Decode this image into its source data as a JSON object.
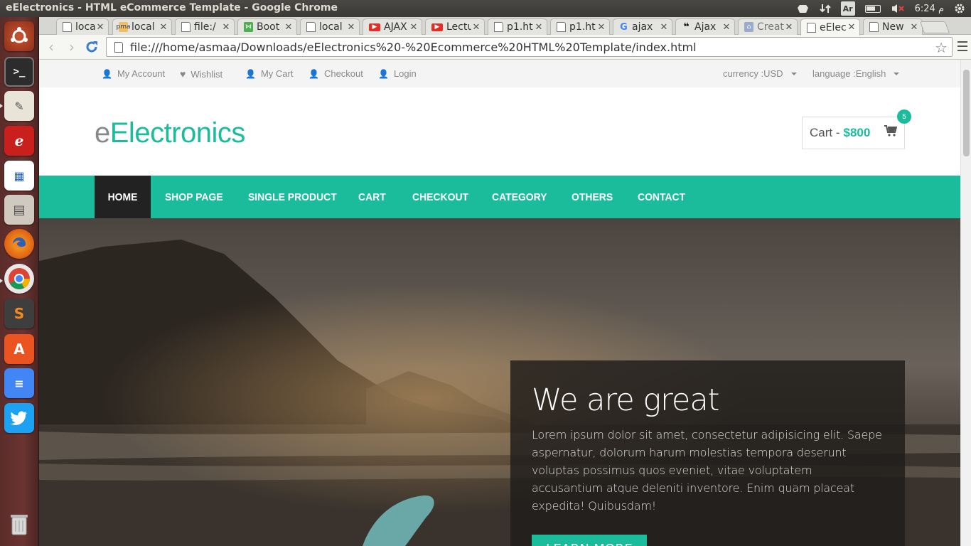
{
  "window": {
    "title": "eElectronics - HTML eCommerce Template - Google Chrome"
  },
  "system_tray": {
    "keyboard": "Ar",
    "clock": "6:24 م"
  },
  "launcher": {
    "items": [
      "ubuntu-dash",
      "terminal",
      "text-editor",
      "pdf-viewer",
      "image-viewer",
      "file-manager",
      "firefox",
      "chrome",
      "sublime-text",
      "software-center",
      "docs",
      "twitter",
      "trash"
    ]
  },
  "browser": {
    "tabs": [
      {
        "label": "locall",
        "icon": "doc"
      },
      {
        "label": "local",
        "icon": "pma"
      },
      {
        "label": "file:/",
        "icon": "doc"
      },
      {
        "label": "Boot",
        "icon": "bootsnipp"
      },
      {
        "label": "local",
        "icon": "doc"
      },
      {
        "label": "AJAX",
        "icon": "youtube"
      },
      {
        "label": "Lectu",
        "icon": "youtube"
      },
      {
        "label": "p1.ht",
        "icon": "doc"
      },
      {
        "label": "p1.ht",
        "icon": "doc"
      },
      {
        "label": "ajax",
        "icon": "google"
      },
      {
        "label": "Ajax",
        "icon": "quotes"
      },
      {
        "label": "Creat",
        "icon": "site"
      },
      {
        "label": "eElec",
        "icon": "doc",
        "active": true
      },
      {
        "label": "New",
        "icon": "doc"
      }
    ],
    "close_glyph": "✕",
    "url": "file:///home/asmaa/Downloads/eElectronics%20-%20Ecommerce%20HTML%20Template/index.html"
  },
  "site": {
    "util_links": {
      "my_account": "My Account",
      "wishlist": "Wishlist",
      "my_cart": "My Cart",
      "checkout": "Checkout",
      "login": "Login"
    },
    "currency": "currency :USD",
    "language": "language :English",
    "logo_prefix": "e",
    "logo_main": "Electronics",
    "cart": {
      "label": "Cart - ",
      "amount": "$800",
      "count": "5"
    },
    "nav": {
      "home": "HOME",
      "shop": "SHOP PAGE",
      "single": "SINGLE PRODUCT",
      "cart": "CART",
      "checkout": "CHECKOUT",
      "category": "CATEGORY",
      "others": "OTHERS",
      "contact": "CONTACT"
    },
    "hero": {
      "heading": "We are great",
      "text": "Lorem ipsum dolor sit amet, consectetur adipisicing elit. Saepe aspernatur, dolorum harum molestias tempora deserunt voluptas possimus quos eveniet, vitae voluptatem accusantium atque deleniti inventore. Enim quam placeat expedita! Quibusdam!",
      "button": "LEARN MORE"
    }
  },
  "colors": {
    "accent": "#1abc9c",
    "nav_active": "#222222",
    "launcher": "#6b3431"
  }
}
